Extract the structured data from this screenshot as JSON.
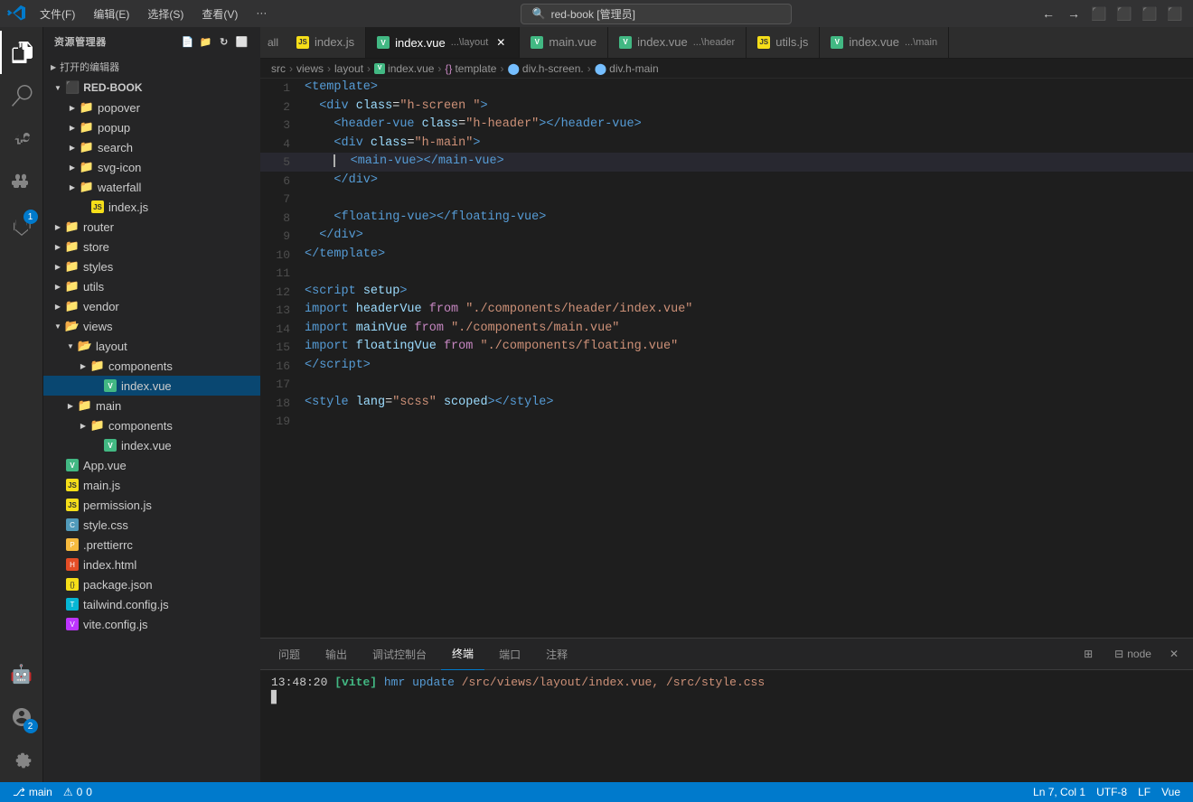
{
  "titlebar": {
    "logo": "VS",
    "menus": [
      "文件(F)",
      "编辑(E)",
      "选择(S)",
      "查看(V)",
      "···"
    ],
    "search_placeholder": "red-book [管理员]",
    "nav_back": "←",
    "nav_forward": "→"
  },
  "tabs": {
    "all_label": "all",
    "items": [
      {
        "id": "tab-indexjs",
        "label": "index.js",
        "type": "js",
        "active": false,
        "closable": false
      },
      {
        "id": "tab-indexvue",
        "label": "index.vue",
        "path": "...\\layout",
        "type": "vue",
        "active": true,
        "closable": true
      },
      {
        "id": "tab-mainvue",
        "label": "main.vue",
        "type": "vue",
        "active": false,
        "closable": false
      },
      {
        "id": "tab-indexvue-header",
        "label": "index.vue",
        "path": "...\\header",
        "type": "vue",
        "active": false,
        "closable": false
      },
      {
        "id": "tab-utilsjs",
        "label": "utils.js",
        "type": "js",
        "active": false,
        "closable": false
      },
      {
        "id": "tab-indexvue-main",
        "label": "index.vue",
        "path": "...\\main",
        "type": "vue",
        "active": false,
        "closable": false
      }
    ]
  },
  "breadcrumb": {
    "items": [
      "src",
      "views",
      "layout",
      "index.vue",
      "{} template",
      "div.h-screen.",
      "div.h-main"
    ]
  },
  "sidebar": {
    "title": "资源管理器",
    "open_editors_label": "打开的编辑器",
    "project_name": "RED-BOOK",
    "tree": [
      {
        "id": "popover",
        "label": "popover",
        "type": "folder",
        "level": 1,
        "collapsed": true
      },
      {
        "id": "popup",
        "label": "popup",
        "type": "folder",
        "level": 1,
        "collapsed": true
      },
      {
        "id": "search",
        "label": "search",
        "type": "folder",
        "level": 1,
        "collapsed": true
      },
      {
        "id": "svg-icon",
        "label": "svg-icon",
        "type": "folder",
        "level": 1,
        "collapsed": true
      },
      {
        "id": "waterfall",
        "label": "waterfall",
        "type": "folder",
        "level": 1,
        "collapsed": true
      },
      {
        "id": "indexjs-src",
        "label": "index.js",
        "type": "js",
        "level": 1
      },
      {
        "id": "router",
        "label": "router",
        "type": "folder",
        "level": 0,
        "collapsed": true
      },
      {
        "id": "store",
        "label": "store",
        "type": "folder",
        "level": 0,
        "collapsed": true
      },
      {
        "id": "styles",
        "label": "styles",
        "type": "folder",
        "level": 0,
        "collapsed": true
      },
      {
        "id": "utils",
        "label": "utils",
        "type": "folder",
        "level": 0,
        "collapsed": true
      },
      {
        "id": "vendor",
        "label": "vendor",
        "type": "folder",
        "level": 0,
        "collapsed": true
      },
      {
        "id": "views",
        "label": "views",
        "type": "folder",
        "level": 0,
        "expanded": true
      },
      {
        "id": "layout",
        "label": "layout",
        "type": "folder",
        "level": 1,
        "expanded": true
      },
      {
        "id": "components",
        "label": "components",
        "type": "folder",
        "level": 2,
        "collapsed": true
      },
      {
        "id": "indexvue-layout",
        "label": "index.vue",
        "type": "vue",
        "level": 2,
        "selected": true
      },
      {
        "id": "main",
        "label": "main",
        "type": "folder",
        "level": 1,
        "collapsed": true
      },
      {
        "id": "components-main",
        "label": "components",
        "type": "folder",
        "level": 2,
        "collapsed": true
      },
      {
        "id": "indexvue-main",
        "label": "index.vue",
        "type": "vue",
        "level": 2
      },
      {
        "id": "appvue",
        "label": "App.vue",
        "type": "vue",
        "level": 0
      },
      {
        "id": "mainjs",
        "label": "main.js",
        "type": "js",
        "level": 0
      },
      {
        "id": "permissionjs",
        "label": "permission.js",
        "type": "js",
        "level": 0
      },
      {
        "id": "stylecss",
        "label": "style.css",
        "type": "css",
        "level": 0
      },
      {
        "id": "prettierrc",
        "label": ".prettierrc",
        "type": "prettier",
        "level": 0
      },
      {
        "id": "indexhtml",
        "label": "index.html",
        "type": "html",
        "level": 0
      },
      {
        "id": "packagejson",
        "label": "package.json",
        "type": "json",
        "level": 0
      },
      {
        "id": "tailwindconfig",
        "label": "tailwind.config.js",
        "type": "tailwind",
        "level": 0
      },
      {
        "id": "viteconfig",
        "label": "vite.config.js",
        "type": "vite",
        "level": 0
      }
    ]
  },
  "editor": {
    "filename": "index.vue",
    "language": "vue",
    "lines": [
      {
        "num": 1,
        "content": ""
      },
      {
        "num": 2,
        "content": ""
      },
      {
        "num": 3,
        "content": ""
      },
      {
        "num": 4,
        "content": ""
      },
      {
        "num": 5,
        "content": ""
      },
      {
        "num": 6,
        "content": ""
      },
      {
        "num": 7,
        "content": ""
      },
      {
        "num": 8,
        "content": ""
      },
      {
        "num": 9,
        "content": ""
      },
      {
        "num": 10,
        "content": ""
      },
      {
        "num": 11,
        "content": ""
      },
      {
        "num": 12,
        "content": ""
      },
      {
        "num": 13,
        "content": ""
      },
      {
        "num": 14,
        "content": ""
      },
      {
        "num": 15,
        "content": ""
      },
      {
        "num": 16,
        "content": ""
      },
      {
        "num": 17,
        "content": ""
      },
      {
        "num": 18,
        "content": ""
      },
      {
        "num": 19,
        "content": ""
      }
    ]
  },
  "terminal": {
    "tabs": [
      "问题",
      "输出",
      "调试控制台",
      "终端",
      "端口",
      "注释"
    ],
    "active_tab": "终端",
    "node_label": "node",
    "log_time": "13:48:20",
    "log_tool": "[vite]",
    "log_action": "hmr update",
    "log_path1": "/src/views/layout/index.vue,",
    "log_path2": "/src/style.css"
  },
  "status_bar": {
    "branch": "main",
    "errors": "0",
    "warnings": "0",
    "language": "Vue",
    "encoding": "UTF-8",
    "line_ending": "LF",
    "position": "Ln 7, Col 1"
  }
}
